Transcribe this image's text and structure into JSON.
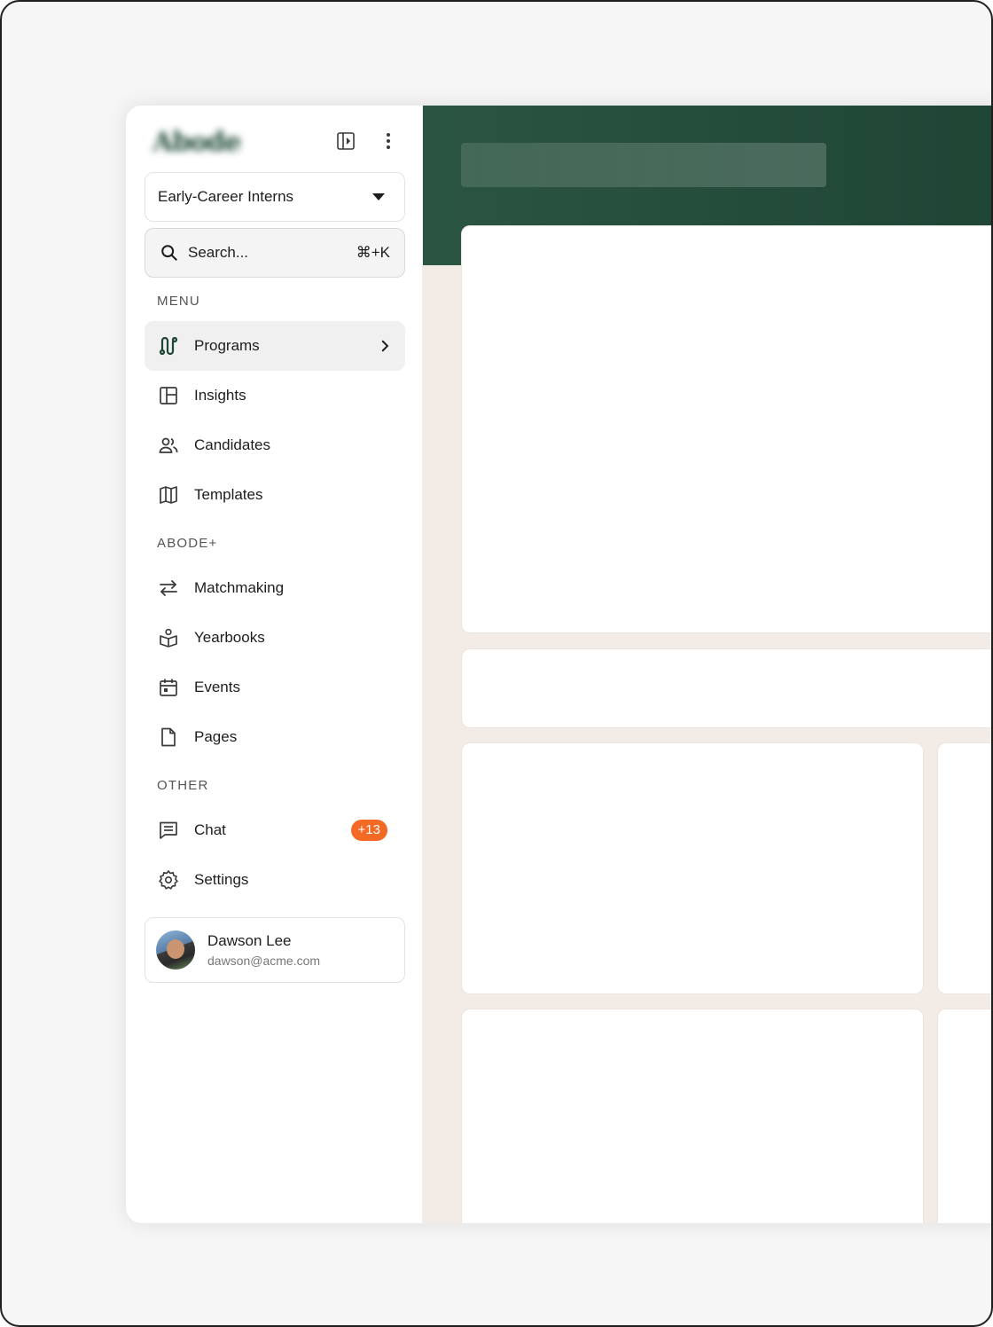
{
  "brand": {
    "logo_text": "Abode"
  },
  "workspace": {
    "selected": "Early-Career Interns"
  },
  "search": {
    "placeholder": "Search...",
    "shortcut": "⌘+K"
  },
  "sections": {
    "menu": "MENU",
    "abode_plus": "ABODE+",
    "other": "OTHER"
  },
  "menu_items": [
    {
      "label": "Programs",
      "icon": "route-icon"
    },
    {
      "label": "Insights",
      "icon": "layout-icon"
    },
    {
      "label": "Candidates",
      "icon": "users-icon"
    },
    {
      "label": "Templates",
      "icon": "map-icon"
    }
  ],
  "abode_items": [
    {
      "label": "Matchmaking",
      "icon": "arrows-swap-icon"
    },
    {
      "label": "Yearbooks",
      "icon": "book-user-icon"
    },
    {
      "label": "Events",
      "icon": "calendar-icon"
    },
    {
      "label": "Pages",
      "icon": "file-icon"
    }
  ],
  "other_items": [
    {
      "label": "Chat",
      "icon": "message-icon",
      "badge": "+13"
    },
    {
      "label": "Settings",
      "icon": "gear-icon"
    }
  ],
  "user": {
    "name": "Dawson Lee",
    "email": "dawson@acme.com"
  },
  "colors": {
    "banner": "#1f4535",
    "badge": "#f26a24",
    "main_bg": "#f3ebe6",
    "active_item_bg": "#f0f0f0"
  }
}
